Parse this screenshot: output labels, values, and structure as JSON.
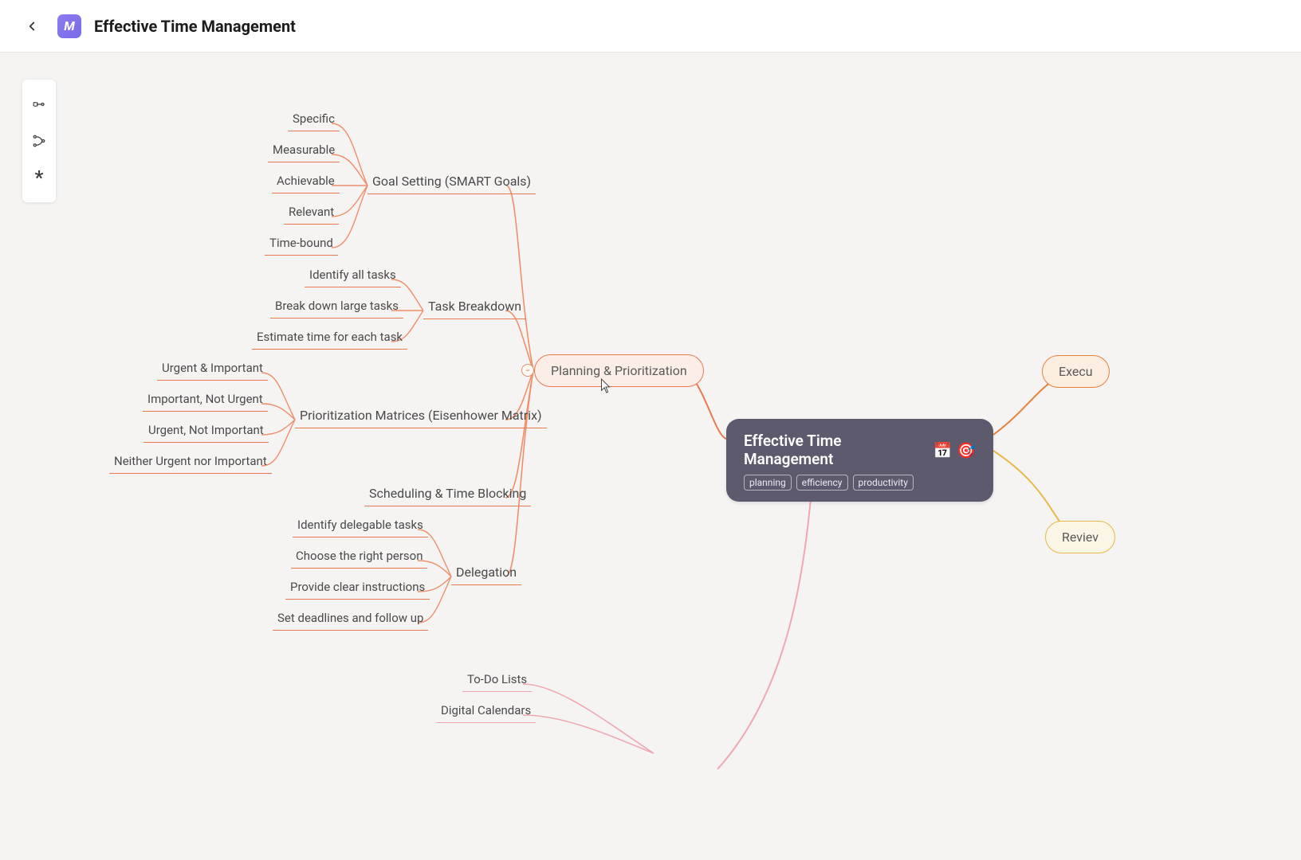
{
  "header": {
    "title": "Effective Time Management",
    "logo_letter": "M"
  },
  "root": {
    "title": "Effective Time Management",
    "emoji1": "📅",
    "emoji2": "🎯",
    "tags": [
      "planning",
      "efficiency",
      "productivity"
    ]
  },
  "planning_node": {
    "label": "Planning & Prioritization"
  },
  "execu_node": {
    "label": "Execu"
  },
  "review_node": {
    "label": "Reviev"
  },
  "branches": {
    "goal_setting": {
      "label": "Goal Setting (SMART Goals)",
      "leaves": [
        "Specific",
        "Measurable",
        "Achievable",
        "Relevant",
        "Time-bound"
      ]
    },
    "task_breakdown": {
      "label": "Task Breakdown",
      "leaves": [
        "Identify all tasks",
        "Break down large tasks",
        "Estimate time for each task"
      ]
    },
    "prioritization": {
      "label": "Prioritization Matrices (Eisenhower Matrix)",
      "leaves": [
        "Urgent & Important",
        "Important, Not Urgent",
        "Urgent, Not Important",
        "Neither Urgent nor Important"
      ]
    },
    "scheduling": {
      "label": "Scheduling & Time Blocking"
    },
    "delegation": {
      "label": "Delegation",
      "leaves": [
        "Identify delegable tasks",
        "Choose the right person",
        "Provide clear instructions",
        "Set deadlines and follow up"
      ]
    },
    "todo_lists": {
      "label": "To-Do Lists"
    },
    "calendars": {
      "label": "Digital Calendars"
    }
  },
  "collapse_symbol": "−",
  "colors": {
    "orange": "#e77a51",
    "orange_light": "#ef8f6a",
    "yellow": "#e8b94b",
    "pink": "#efa8b2"
  }
}
